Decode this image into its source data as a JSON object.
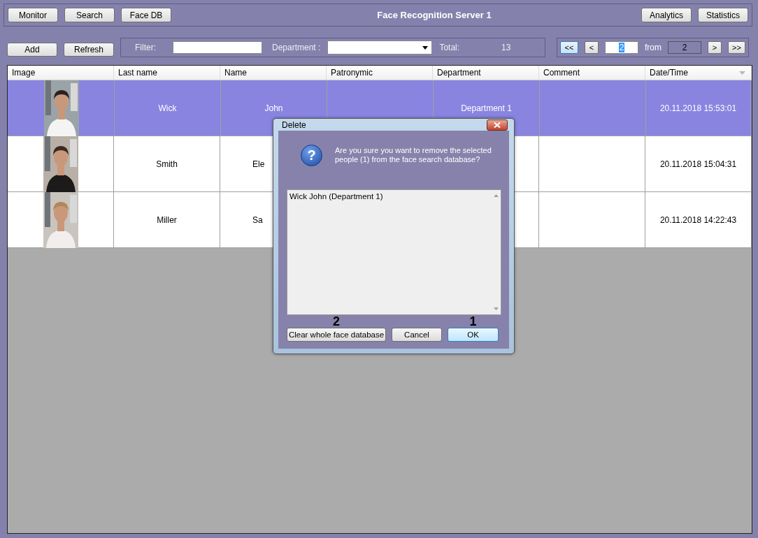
{
  "nav_buttons": [
    "Monitor",
    "Search",
    "Face DB"
  ],
  "title": "Face Recognition Server 1",
  "right_buttons": [
    "Analytics",
    "Statistics"
  ],
  "actions": [
    "Add",
    "Refresh"
  ],
  "filter": {
    "label": "Filter:"
  },
  "department": {
    "label": "Department :"
  },
  "total": {
    "label": "Total:",
    "value": "13"
  },
  "pager": {
    "first": "<<",
    "prev": "<",
    "page": "2",
    "from_label": "from",
    "pages": "2",
    "next": ">",
    "last": ">>"
  },
  "table": {
    "columns": [
      "Image",
      "Last name",
      "Name",
      "Patronymic",
      "Department",
      "Comment",
      "Date/Time"
    ],
    "rows": [
      {
        "selected": true,
        "last_name": "Wick",
        "name": {
          "text": "John",
          "covered": false
        },
        "department": "Department 1",
        "datetime": "20.11.2018 15:53:01"
      },
      {
        "selected": false,
        "last_name": "Smith",
        "name": {
          "text": "Ele",
          "covered": true
        },
        "datetime": "20.11.2018 15:04:31"
      },
      {
        "selected": false,
        "last_name": "Miller",
        "name": {
          "text": "Sa",
          "covered": true
        },
        "datetime": "20.11.2018 14:22:43"
      }
    ]
  },
  "dialog": {
    "title": "Delete",
    "icon": "?",
    "message": "Are you sure you want to remove the selected people (1) from the face search database?",
    "list": [
      "Wick John  (Department 1)"
    ],
    "buttons": [
      {
        "label": "Clear whole face database",
        "callout": "2",
        "selected": false
      },
      {
        "label": "Cancel",
        "selected": false
      },
      {
        "label": "OK",
        "callout": "1",
        "selected": true
      }
    ]
  }
}
